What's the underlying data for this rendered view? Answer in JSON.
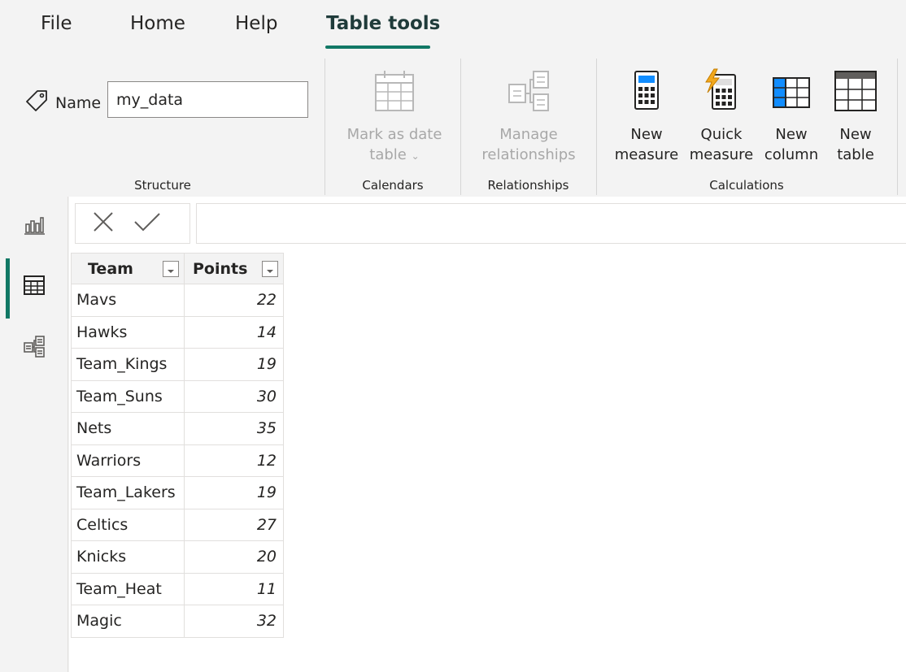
{
  "menu": {
    "tabs": [
      {
        "label": "File"
      },
      {
        "label": "Home"
      },
      {
        "label": "Help"
      },
      {
        "label": "Table tools"
      }
    ],
    "active_tab": "Table tools"
  },
  "ribbon": {
    "structure": {
      "group_label": "Structure",
      "name_label": "Name",
      "name_value": "my_data"
    },
    "calendars": {
      "group_label": "Calendars",
      "mark_as_date_line1": "Mark as date",
      "mark_as_date_line2": "table"
    },
    "relationships": {
      "group_label": "Relationships",
      "manage_line1": "Manage",
      "manage_line2": "relationships"
    },
    "calculations": {
      "group_label": "Calculations",
      "new_measure_line1": "New",
      "new_measure_line2": "measure",
      "quick_measure_line1": "Quick",
      "quick_measure_line2": "measure",
      "new_column_line1": "New",
      "new_column_line2": "column",
      "new_table_line1": "New",
      "new_table_line2": "table"
    }
  },
  "rail": {
    "items": [
      {
        "icon": "report-view-icon"
      },
      {
        "icon": "table-view-icon",
        "active": true
      },
      {
        "icon": "model-view-icon"
      }
    ]
  },
  "table": {
    "columns": [
      "Team",
      "Points"
    ],
    "rows": [
      {
        "team": "Mavs",
        "points": "22"
      },
      {
        "team": "Hawks",
        "points": "14"
      },
      {
        "team": "Team_Kings",
        "points": "19"
      },
      {
        "team": "Team_Suns",
        "points": "30"
      },
      {
        "team": "Nets",
        "points": "35"
      },
      {
        "team": "Warriors",
        "points": "12"
      },
      {
        "team": "Team_Lakers",
        "points": "19"
      },
      {
        "team": "Celtics",
        "points": "27"
      },
      {
        "team": "Knicks",
        "points": "20"
      },
      {
        "team": "Team_Heat",
        "points": "11"
      },
      {
        "team": "Magic",
        "points": "32"
      }
    ]
  },
  "colors": {
    "accent": "#117865",
    "background": "#f3f3f3",
    "disabled_text": "#a8a8a8"
  }
}
